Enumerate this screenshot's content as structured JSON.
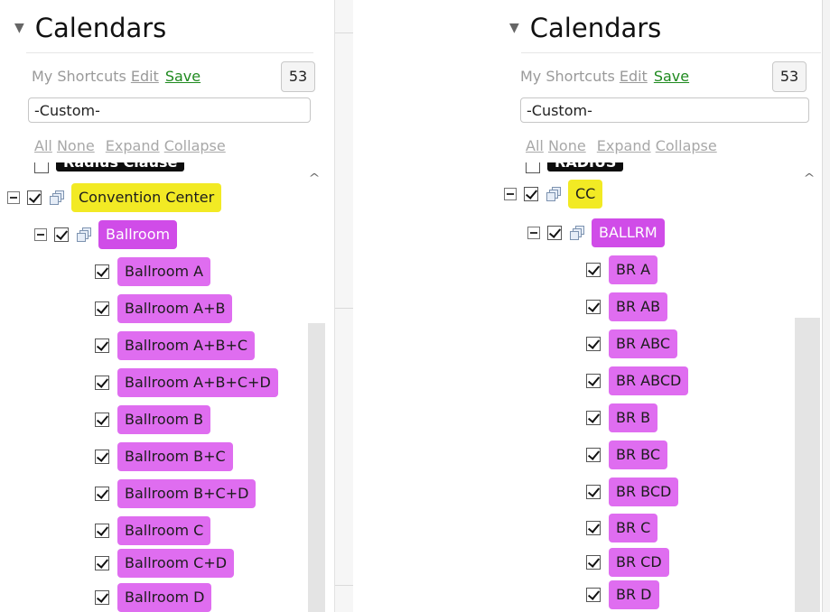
{
  "left": {
    "header": {
      "title": "Calendars"
    },
    "shortcuts": {
      "label": "My Shortcuts",
      "edit": "Edit",
      "save": "Save",
      "count": "53"
    },
    "selector": {
      "value": "-Custom-"
    },
    "actions": {
      "all": "All",
      "none": "None",
      "expand": "Expand",
      "collapse": "Collapse"
    },
    "clipped_item": "Radius Clause",
    "tree": {
      "root": "Convention Center",
      "group": "Ballroom",
      "items": [
        "Ballroom A",
        "Ballroom A+B",
        "Ballroom A+B+C",
        "Ballroom A+B+C+D",
        "Ballroom B",
        "Ballroom B+C",
        "Ballroom B+C+D",
        "Ballroom C",
        "Ballroom C+D",
        "Ballroom D"
      ]
    }
  },
  "right": {
    "header": {
      "title": "Calendars"
    },
    "shortcuts": {
      "label": "My Shortcuts",
      "edit": "Edit",
      "save": "Save",
      "count": "53"
    },
    "selector": {
      "value": "-Custom-"
    },
    "actions": {
      "all": "All",
      "none": "None",
      "expand": "Expand",
      "collapse": "Collapse"
    },
    "clipped_item": "RADIUS",
    "tree": {
      "root": "CC",
      "group": "BALLRM",
      "items": [
        "BR A",
        "BR AB",
        "BR ABC",
        "BR ABCD",
        "BR B",
        "BR BC",
        "BR BCD",
        "BR C",
        "BR CD",
        "BR D"
      ]
    }
  },
  "colors": {
    "root_tag": "#f2ea24",
    "group_tag": "#d04ce8",
    "item_tag": "#df6df0",
    "save_link": "#1f8a1f"
  },
  "icons": [
    "collapse-triangle-icon",
    "collapse-minus-icon",
    "checkbox-icon",
    "calendar-stack-icon",
    "scroll-up-arrow-icon"
  ]
}
